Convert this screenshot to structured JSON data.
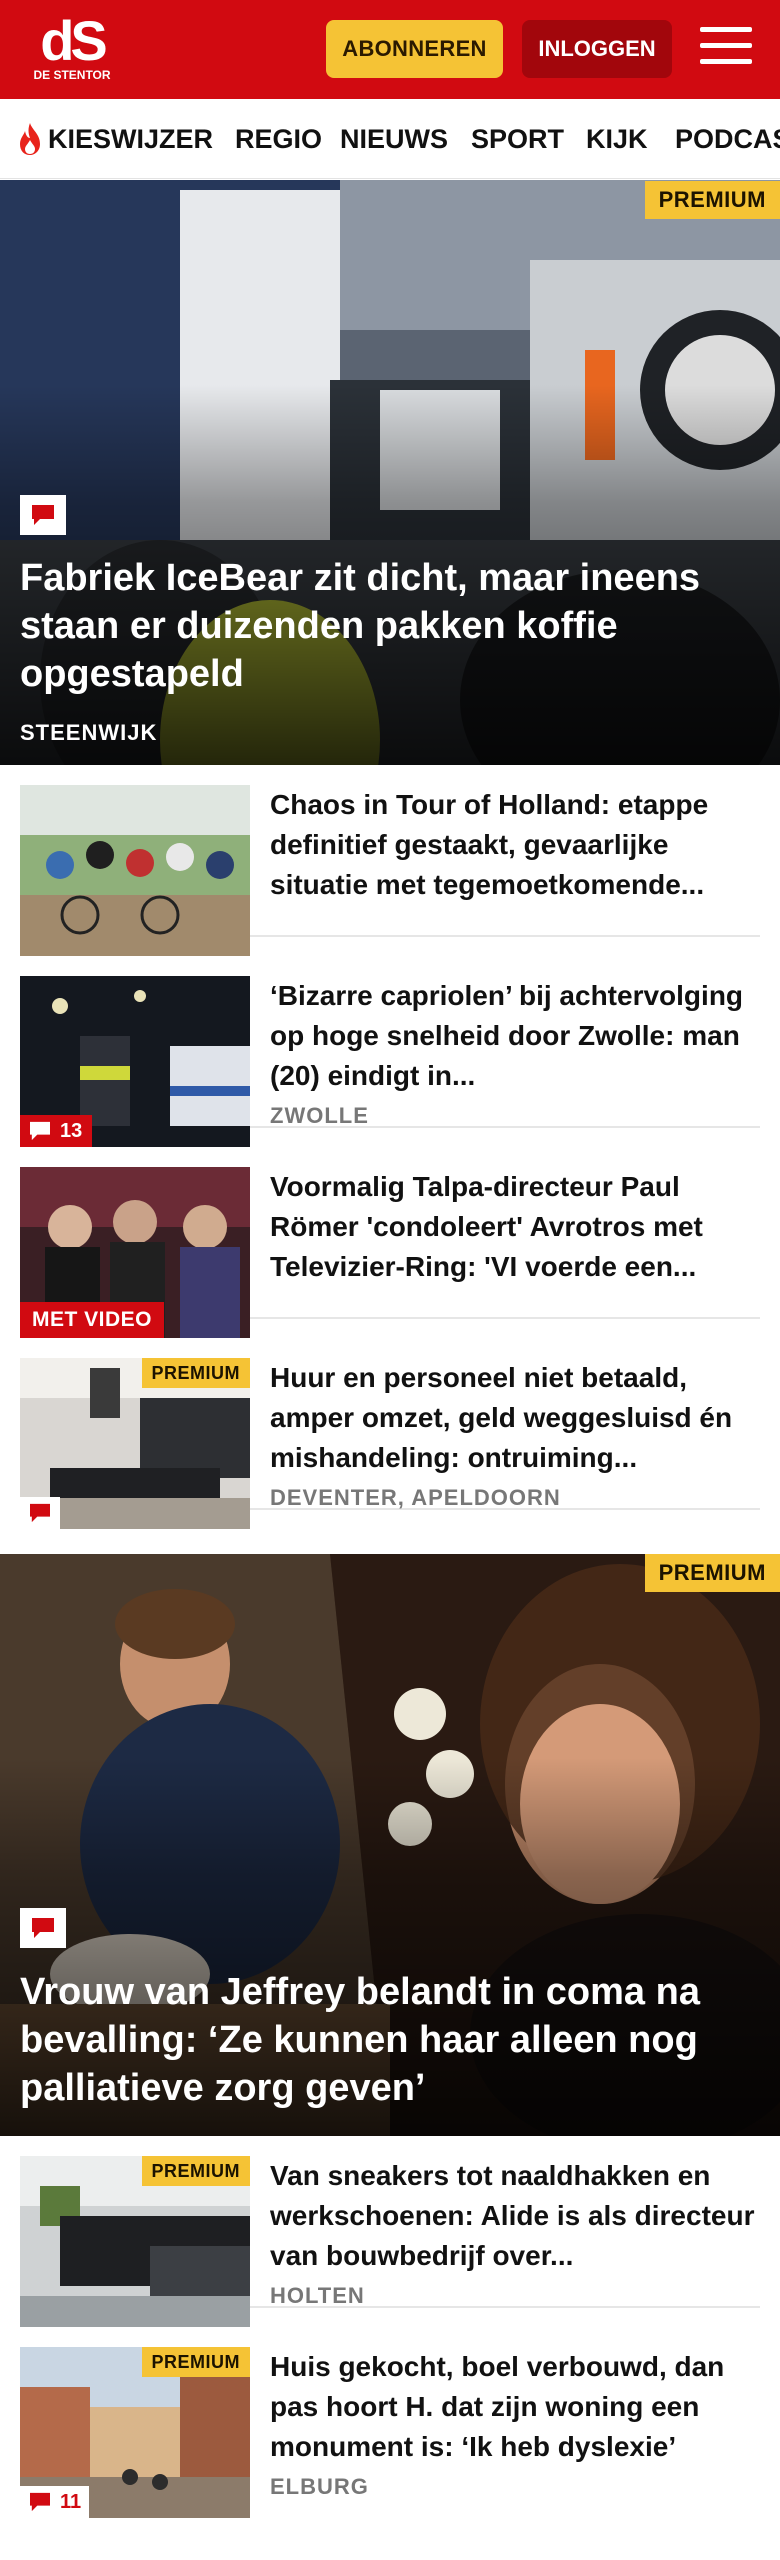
{
  "header": {
    "logo_mark": "dS",
    "logo_sub": "DE STENTOR",
    "subscribe_label": "ABONNEREN",
    "login_label": "INLOGGEN",
    "menu_icon": "hamburger-icon",
    "brand_color": "#d10a11",
    "accent_color": "#f5c335"
  },
  "nav": {
    "items": [
      {
        "label": "KIESWIJZER",
        "icon": "flame-icon"
      },
      {
        "label": "REGIO"
      },
      {
        "label": "NIEUWS"
      },
      {
        "label": "SPORT"
      },
      {
        "label": "KIJK"
      },
      {
        "label": "PODCAS"
      }
    ]
  },
  "hero1": {
    "premium": "PREMIUM",
    "title": "Fabriek IceBear zit dicht, maar ineens staan er duizenden pakken koffie opgestapeld",
    "label": "STEENWIJK",
    "comment_icon": "comment-icon"
  },
  "articles1": [
    {
      "title": "Chaos in Tour of Holland: etappe definitief gestaakt, gevaarlijke situatie met tegemoetkomende...",
      "meta": ""
    },
    {
      "title": "‘Bizarre capriolen’ bij achtervol­ging op hoge snelheid door Zwolle: man (20) eindigt in...",
      "meta": "ZWOLLE",
      "comments": "13"
    },
    {
      "title": "Voormalig Talpa-directeur Paul Römer 'condoleert' Avrotros met Televizier-Ring: 'VI voerde een...",
      "meta": "",
      "badge": "MET VIDEO"
    },
    {
      "title": "Huur en personeel niet betaald, amper omzet, geld weggesluisd én mishandeling: ontruiming...",
      "meta": "DEVENTER, APELDOORN",
      "premium": "PREMIUM"
    }
  ],
  "hero2": {
    "premium": "PREMIUM",
    "title": "Vrouw van Jeffrey belandt in coma na bevalling: ‘Ze kunnen haar alleen nog palliatieve zorg geven’",
    "comment_icon": "comment-icon"
  },
  "articles2": [
    {
      "title": "Van sneakers tot naaldhakken en werkschoenen: Alide is als directeur van bouwbedrijf over...",
      "meta": "HOLTEN",
      "premium": "PREMIUM"
    },
    {
      "title": "Huis gekocht, boel verbouwd, dan pas hoort H. dat zijn woning een monument is: ‘Ik heb dyslexie’",
      "meta": "ELBURG",
      "premium": "PREMIUM",
      "comments": "11"
    }
  ]
}
